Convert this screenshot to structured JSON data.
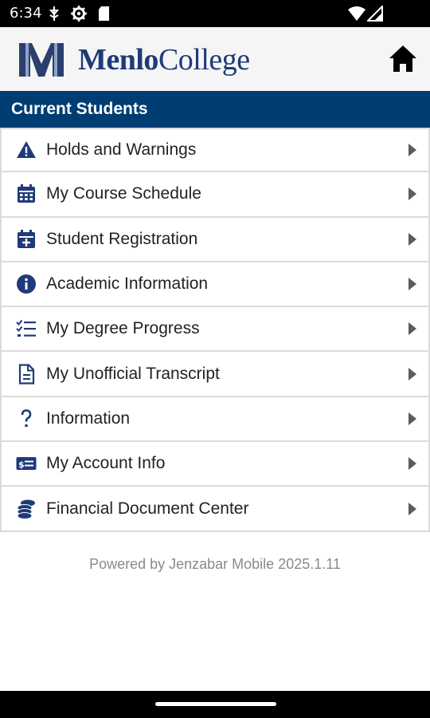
{
  "status_bar": {
    "time": "6:34",
    "icons": [
      "usb-debug-icon",
      "settings-gear-icon",
      "sd-card-icon",
      "wifi-icon",
      "signal-icon"
    ]
  },
  "header": {
    "logo_word_bold": "Menlo",
    "logo_word_regular": "College",
    "brand_color": "#1e3a78",
    "home_icon": "home-icon"
  },
  "section": {
    "title": "Current Students",
    "bg_color": "#003d73"
  },
  "menu": {
    "items": [
      {
        "label": "Holds and Warnings",
        "icon": "warning-icon"
      },
      {
        "label": "My Course Schedule",
        "icon": "calendar-icon"
      },
      {
        "label": "Student Registration",
        "icon": "calendar-plus-icon"
      },
      {
        "label": "Academic Information",
        "icon": "info-circle-icon"
      },
      {
        "label": "My Degree Progress",
        "icon": "checklist-icon"
      },
      {
        "label": "My Unofficial Transcript",
        "icon": "document-icon"
      },
      {
        "label": "Information",
        "icon": "question-icon"
      },
      {
        "label": "My Account Info",
        "icon": "money-card-icon"
      },
      {
        "label": "Financial Document Center",
        "icon": "coin-stack-icon"
      }
    ]
  },
  "footer": {
    "text": "Powered by Jenzabar Mobile 2025.1.11"
  }
}
